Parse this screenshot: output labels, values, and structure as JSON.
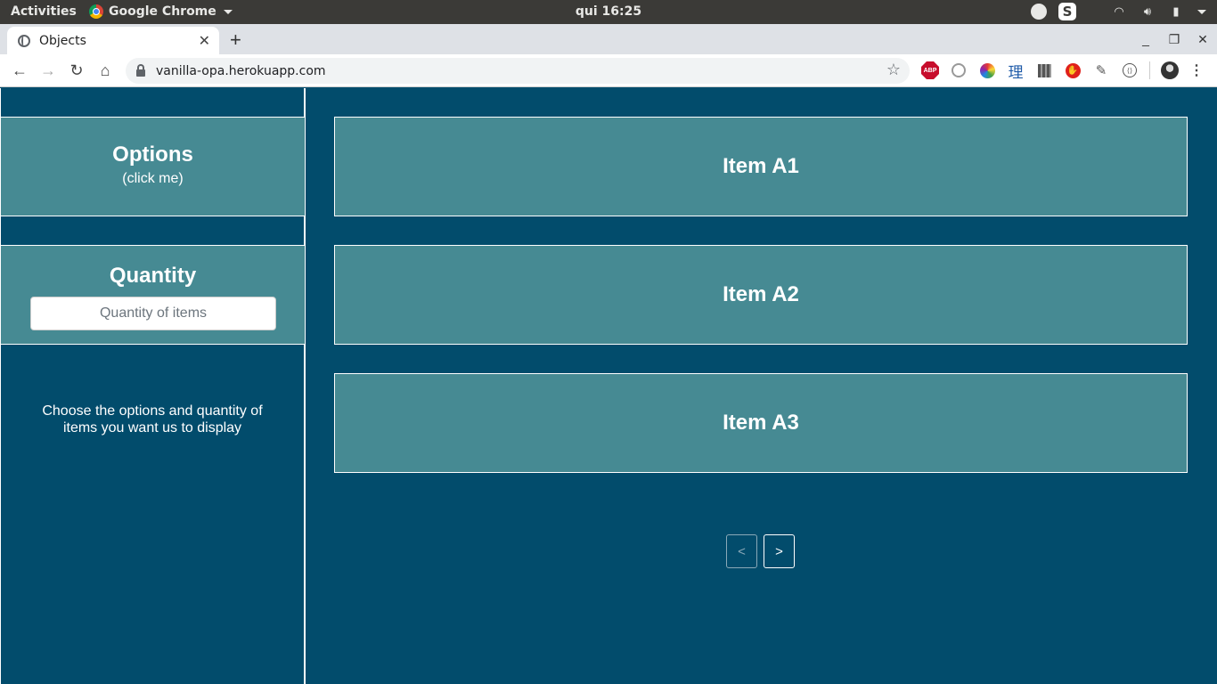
{
  "system": {
    "activities_label": "Activities",
    "app_name": "Google Chrome",
    "clock": "qui 16:25"
  },
  "browser": {
    "tab_title": "Objects",
    "tab_close": "✕",
    "new_tab": "+",
    "url": "vanilla-opa.herokuapp.com",
    "abp_label": "ABP",
    "kanji_label": "理"
  },
  "sidebar": {
    "options": {
      "title": "Options",
      "subtitle": "(click me)"
    },
    "quantity": {
      "title": "Quantity",
      "placeholder": "Quantity of items",
      "value": ""
    },
    "help_text": "Choose the options and quantity of items you want us to display"
  },
  "items": [
    {
      "label": "Item A1"
    },
    {
      "label": "Item A2"
    },
    {
      "label": "Item A3"
    }
  ],
  "pager": {
    "prev_label": "<",
    "next_label": ">"
  },
  "colors": {
    "page_background": "#024c6c",
    "panel_background": "#468a93",
    "border": "#ffffff"
  }
}
